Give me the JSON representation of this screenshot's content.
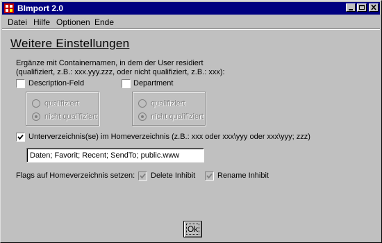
{
  "window": {
    "title": "BImport 2.0",
    "titlebar_color": "#000080"
  },
  "menu": [
    {
      "label": "Datei"
    },
    {
      "label": "Hilfe"
    },
    {
      "label": "Optionen"
    },
    {
      "label": "Ende"
    }
  ],
  "page": {
    "heading": "Weitere Einstellungen",
    "container_info_line1": "Ergänze mit Containernamen, in dem der User residiert",
    "container_info_line2": "(qualifiziert, z.B.: xxx.yyy.zzz, oder nicht qualifiziert, z.B.: xxx):"
  },
  "description_field": {
    "label": "Description-Feld",
    "checked": false,
    "options": [
      "qualifiziert",
      "nicht qualifiziert"
    ],
    "selected": "nicht qualifiziert"
  },
  "department": {
    "label": "Department",
    "checked": false,
    "options": [
      "qualifiziert",
      "nicht qualifiziert"
    ],
    "selected": "nicht qualifiziert"
  },
  "subdirs": {
    "label": "Unterverzeichnis(se) im Homeverzeichnis (z.B.: xxx oder xxx\\yyy oder xxx\\yyy; zzz)",
    "checked": true,
    "value": "Daten; Favorit; Recent; SendTo; public.www"
  },
  "flags": {
    "label": "Flags auf Homeverzeichnis setzen:",
    "delete_inhibit": {
      "label": "Delete Inhibit",
      "checked": true
    },
    "rename_inhibit": {
      "label": "Rename Inhibit",
      "checked": true
    }
  },
  "buttons": {
    "ok": "Ok"
  }
}
